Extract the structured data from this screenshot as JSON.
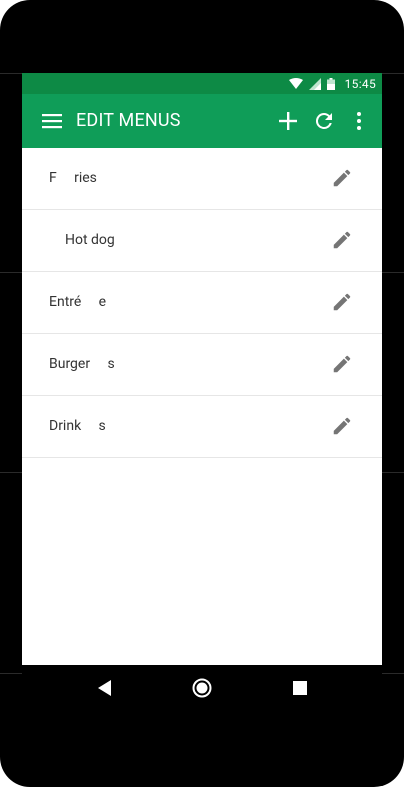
{
  "status_bar": {
    "time": "15:45"
  },
  "app_bar": {
    "title": "EDIT MENUS"
  },
  "menus": [
    {
      "label": "F     ries"
    },
    {
      "label": "Hot dog"
    },
    {
      "label": "Entré     e"
    },
    {
      "label": "Burger     s"
    },
    {
      "label": "Drink     s"
    }
  ],
  "colors": {
    "app_bar": "#0f9d58",
    "status_bar": "#0d8a45"
  }
}
